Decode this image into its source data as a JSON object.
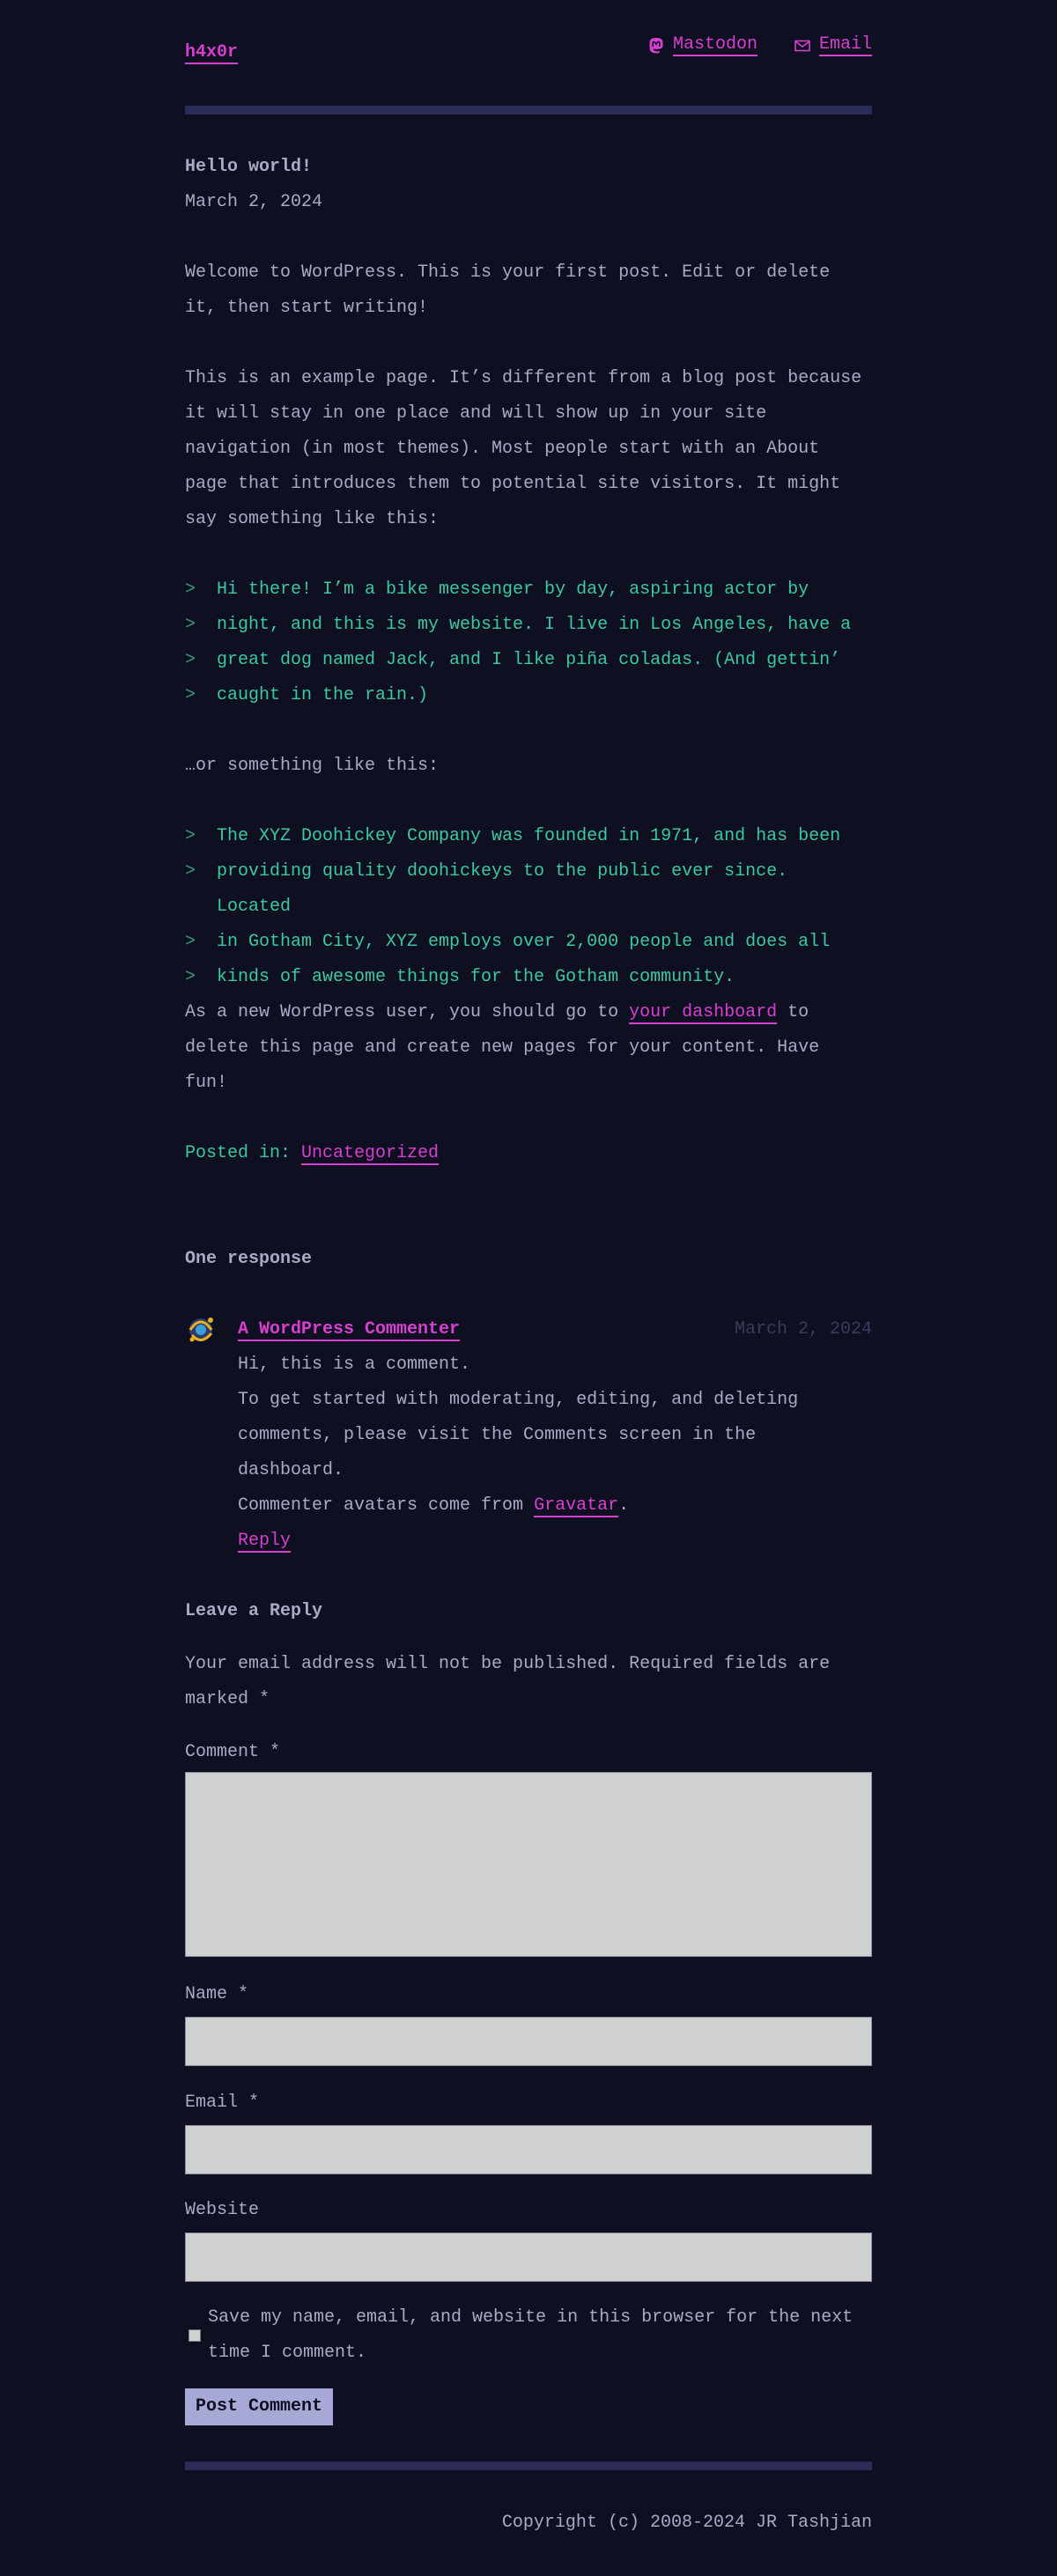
{
  "header": {
    "site_title": "h4x0r",
    "nav": [
      {
        "label": "Mastodon",
        "icon": "mastodon-icon"
      },
      {
        "label": "Email",
        "icon": "mail-icon"
      }
    ]
  },
  "post": {
    "title": "Hello world!",
    "date": "March 2, 2024",
    "intro": "Welcome to WordPress. This is your first post. Edit or delete it, then start writing!",
    "para1": "This is an example page. It’s different from a blog post because it will stay in one place and will show up in your site navigation (in most themes). Most people start with an About page that introduces them to potential site visitors. It might say something like this:",
    "quote1": [
      "Hi there! I’m a bike messenger by day, aspiring actor by",
      "night, and this is my website. I live in Los Angeles, have a",
      "great dog named Jack, and I like piña coladas. (And gettin’",
      "caught in the rain.)"
    ],
    "or_text": "…or something like this:",
    "quote2": [
      "The XYZ Doohickey Company was founded in 1971, and has been",
      "providing quality doohickeys to the public ever since. Located",
      "in Gotham City, XYZ employs over 2,000 people and does all",
      "kinds of awesome things for the Gotham community."
    ],
    "closing_pre": "As a new WordPress user, you should go to ",
    "closing_link": "your dashboard",
    "closing_post": " to delete this page and create new pages for your content. Have fun!",
    "posted_in_label": "Posted in: ",
    "category": "Uncategorized"
  },
  "comments": {
    "heading": "One response",
    "items": [
      {
        "author": "A WordPress Commenter",
        "date": "March 2, 2024",
        "line1": "Hi, this is a comment.",
        "line2": "To get started with moderating, editing, and deleting comments, please visit the Comments screen in the dashboard.",
        "line3_pre": "Commenter avatars come from ",
        "line3_link": "Gravatar",
        "line3_post": ".",
        "reply": "Reply"
      }
    ]
  },
  "reply_form": {
    "heading": "Leave a Reply",
    "notice": "Your email address will not be published. Required fields are marked *",
    "comment_label": "Comment *",
    "name_label": "Name *",
    "email_label": "Email *",
    "website_label": "Website",
    "save_label": "Save my name, email, and website in this browser for the next time I comment.",
    "submit_label": "Post Comment"
  },
  "footer": {
    "copyright": "Copyright (c) 2008-2024 JR Tashjian"
  },
  "colors": {
    "background": "#0e0f20",
    "text": "#a9aac6",
    "link": "#d83fd0",
    "quote": "#3cc8a0",
    "rule": "#2b2d58",
    "button": "#a8a8d6"
  }
}
